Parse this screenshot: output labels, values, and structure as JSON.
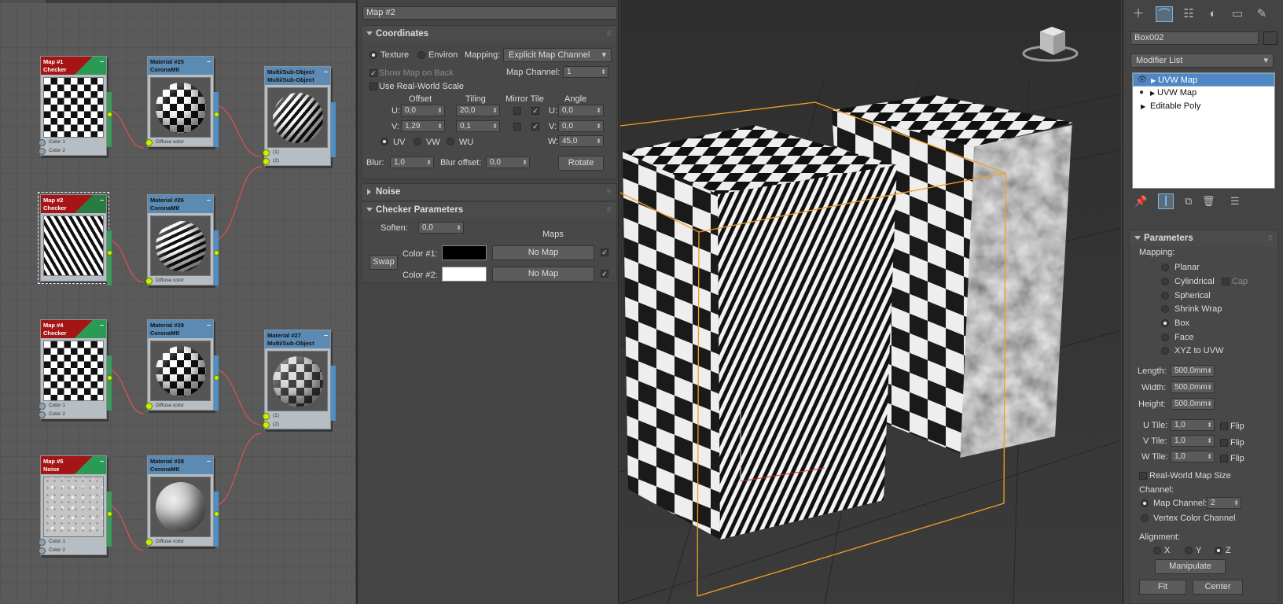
{
  "node_editor": {
    "nodes": [
      {
        "id": "map1",
        "title1": "Map #1",
        "title2": "Checker",
        "kind": "map",
        "thumb": "checker",
        "slots": [
          "Color 1",
          "Color 2"
        ]
      },
      {
        "id": "mat25",
        "title1": "Material #25",
        "title2": "CoronaMtl",
        "kind": "mat",
        "thumb": "checker",
        "slots": [
          "Diffuse color"
        ]
      },
      {
        "id": "multi1",
        "title1": "Multi/Sub-Object",
        "title2": "Multi/Sub-Object",
        "kind": "mat",
        "thumb": "stripe",
        "slots": [
          "(1)",
          "(2)"
        ]
      },
      {
        "id": "map2",
        "title1": "Map #2",
        "title2": "Checker",
        "kind": "map",
        "thumb": "stripe",
        "slots": []
      },
      {
        "id": "mat26",
        "title1": "Material #26",
        "title2": "CoronaMtl",
        "kind": "mat",
        "thumb": "stripe",
        "slots": [
          "Diffuse color"
        ]
      },
      {
        "id": "map4",
        "title1": "Map #4",
        "title2": "Checker",
        "kind": "map",
        "thumb": "checker",
        "slots": [
          "Color 1",
          "Color 2"
        ]
      },
      {
        "id": "mat29",
        "title1": "Material #29",
        "title2": "CoronaMtl",
        "kind": "mat",
        "thumb": "checker",
        "slots": [
          "Diffuse color"
        ]
      },
      {
        "id": "mat27",
        "title1": "Material #27",
        "title2": "Multi/Sub-Object",
        "kind": "mat",
        "thumb": "checker",
        "slots": [
          "(1)",
          "(2)"
        ]
      },
      {
        "id": "map5",
        "title1": "Map #5",
        "title2": "Noise",
        "kind": "map",
        "thumb": "noise",
        "slots": [
          "Color 1",
          "Color 2"
        ]
      },
      {
        "id": "mat28",
        "title1": "Material #28",
        "title2": "CoronaMtl",
        "kind": "mat",
        "thumb": "noise",
        "slots": [
          "Diffuse color"
        ]
      }
    ]
  },
  "params": {
    "title": "Map #2",
    "coordinates": {
      "header": "Coordinates",
      "texture": "Texture",
      "environ": "Environ",
      "mapping_label": "Mapping:",
      "mapping_value": "Explicit Map Channel",
      "show_map_on_back": "Show Map on Back",
      "map_channel_label": "Map Channel:",
      "map_channel_value": "1",
      "use_real_world": "Use Real-World Scale",
      "offset": "Offset",
      "tiling": "Tiling",
      "mirror_tile": "Mirror Tile",
      "angle": "Angle",
      "u_label": "U:",
      "v_label": "V:",
      "w_label": "W:",
      "offset_u": "0,0",
      "offset_v": "1,29",
      "tiling_u": "20,0",
      "tiling_v": "0,1",
      "angle_u": "0,0",
      "angle_v": "0,0",
      "angle_w": "45,0",
      "uv": "UV",
      "vw": "VW",
      "wu": "WU",
      "blur_label": "Blur:",
      "blur_value": "1,0",
      "blur_offset_label": "Blur offset:",
      "blur_offset_value": "0,0",
      "rotate": "Rotate"
    },
    "noise": {
      "header": "Noise"
    },
    "checker": {
      "header": "Checker Parameters",
      "soften_label": "Soften:",
      "soften_value": "0,0",
      "maps": "Maps",
      "color1_label": "Color #1:",
      "color2_label": "Color #2:",
      "color1": "#000000",
      "color2": "#ffffff",
      "no_map": "No Map",
      "swap": "Swap"
    }
  },
  "command_panel": {
    "object_name": "Box002",
    "modifier_list": "Modifier List",
    "stack": [
      {
        "label": "UVW Map",
        "selected": true,
        "eye": true
      },
      {
        "label": "UVW Map",
        "selected": false,
        "eye": true
      },
      {
        "label": "Editable Poly",
        "selected": false,
        "eye": false
      }
    ],
    "parameters_header": "Parameters",
    "mapping_label": "Mapping:",
    "mapping_options": [
      "Planar",
      "Cylindrical",
      "Spherical",
      "Shrink Wrap",
      "Box",
      "Face",
      "XYZ to UVW"
    ],
    "mapping_selected": "Box",
    "cap": "Cap",
    "length_label": "Length:",
    "length": "500,0mm",
    "width_label": "Width:",
    "width": "500,0mm",
    "height_label": "Height:",
    "height": "500,0mm",
    "utile_label": "U Tile:",
    "utile": "1,0",
    "vtile_label": "V Tile:",
    "vtile": "1,0",
    "wtile_label": "W Tile:",
    "wtile": "1,0",
    "flip": "Flip",
    "real_world": "Real-World Map Size",
    "channel_label": "Channel:",
    "map_channel_label": "Map Channel:",
    "map_channel": "2",
    "vertex_color_channel": "Vertex Color Channel",
    "alignment_label": "Alignment:",
    "x": "X",
    "y": "Y",
    "z": "Z",
    "manipulate": "Manipulate",
    "fit": "Fit",
    "center": "Center"
  }
}
